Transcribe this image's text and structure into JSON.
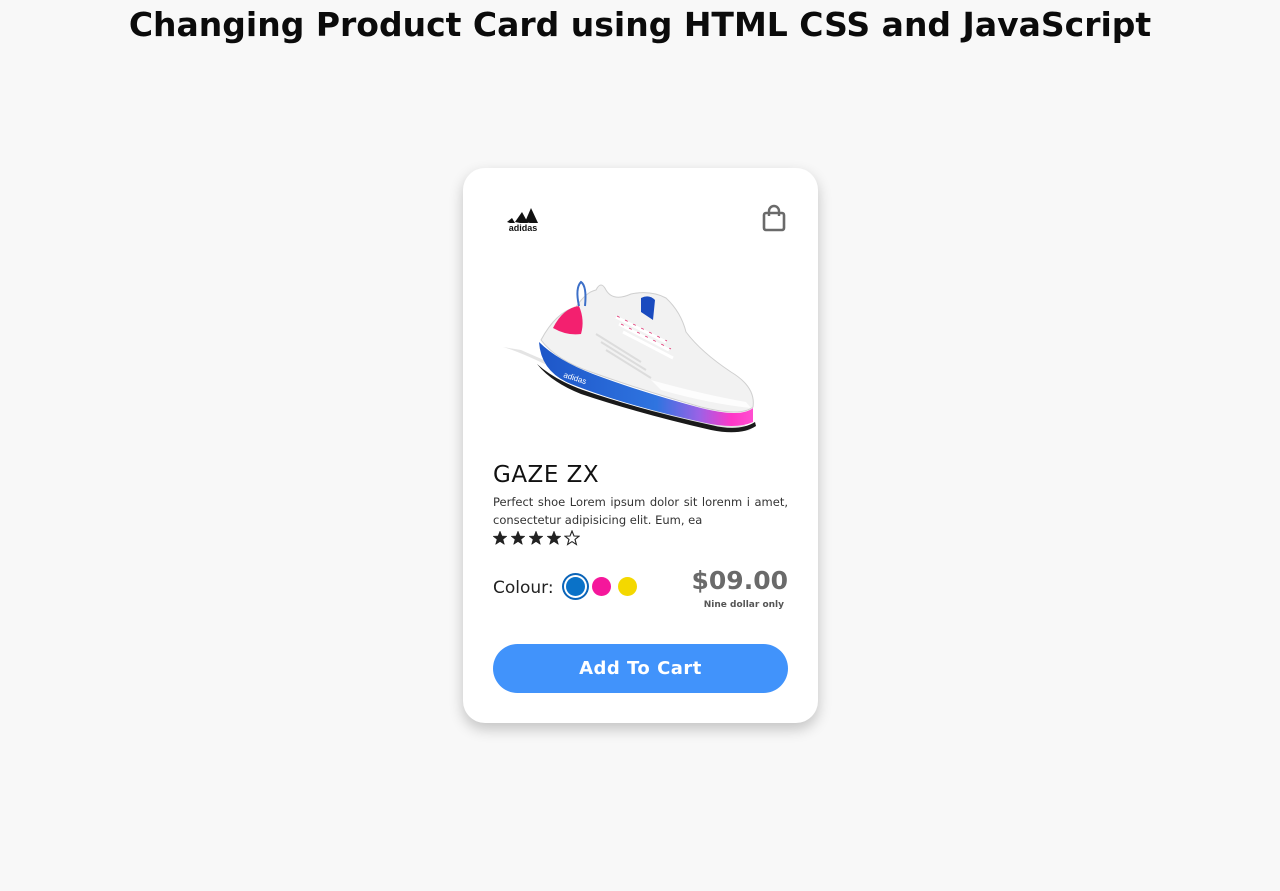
{
  "page": {
    "title": "Changing Product Card using HTML CSS and JavaScript"
  },
  "card": {
    "brand_icon": "adidas-logo-icon",
    "bag_icon": "shopping-bag-icon",
    "product_name": "GAZE ZX",
    "description": "Perfect shoe Lorem ipsum dolor sit lorenm i amet, consectetur adipisicing elit. Eum, ea",
    "rating": 4,
    "rating_max": 5,
    "colour_label": "Colour:",
    "colours": [
      {
        "name": "blue",
        "hex": "#0a72c8",
        "selected": true
      },
      {
        "name": "pink",
        "hex": "#f5179b",
        "selected": false
      },
      {
        "name": "yellow",
        "hex": "#f4d800",
        "selected": false
      }
    ],
    "price": "$09.00",
    "price_note": "Nine dollar only",
    "add_to_cart_label": "Add To Cart",
    "button_color": "#4193fb"
  }
}
